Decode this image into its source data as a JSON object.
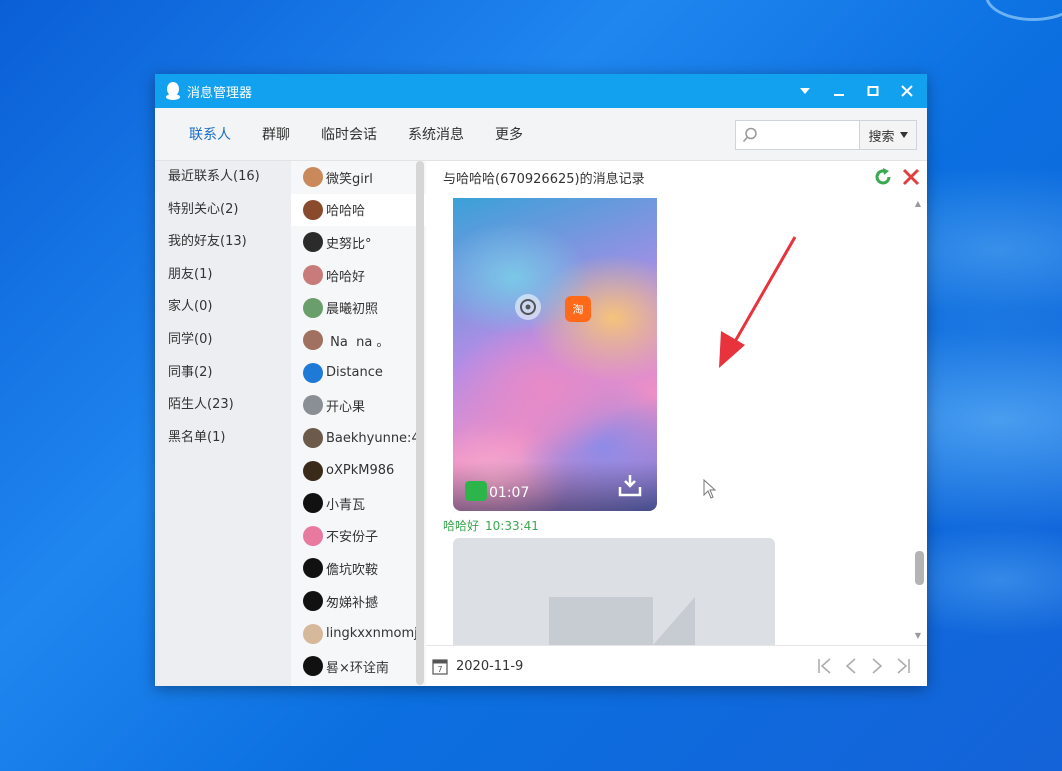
{
  "window": {
    "title": "消息管理器"
  },
  "nav": {
    "tabs": [
      {
        "label": "联系人"
      },
      {
        "label": "群聊"
      },
      {
        "label": "临时会话"
      },
      {
        "label": "系统消息"
      },
      {
        "label": "更多"
      }
    ],
    "active_tab": "联系人",
    "search_placeholder": "",
    "search_button": "搜索"
  },
  "groups": [
    "最近联系人(16)",
    "特别关心(2)",
    "我的好友(13)",
    "朋友(1)",
    "家人(0)",
    "同学(0)",
    "同事(2)",
    "陌生人(23)",
    "黑名单(1)"
  ],
  "contacts": [
    {
      "name": "微笑girl",
      "avatar_color": "#c9895a"
    },
    {
      "name": "哈哈哈",
      "avatar_color": "#8a4a2c",
      "selected": true
    },
    {
      "name": "史努比°",
      "avatar_color": "#2b2b2b"
    },
    {
      "name": "哈哈好",
      "avatar_color": "#c97a7a"
    },
    {
      "name": "晨曦初照",
      "avatar_color": "#6a9e6a"
    },
    {
      "name": " Na  na 。",
      "avatar_color": "#a07060"
    },
    {
      "name": "Distance",
      "avatar_color": "#1e7ad6"
    },
    {
      "name": "开心果",
      "avatar_color": "#8a8f96"
    },
    {
      "name": "Baekhyunne:4",
      "avatar_color": "#6c5a4a"
    },
    {
      "name": "oXPkM986",
      "avatar_color": "#3a2a1a"
    },
    {
      "name": "小青瓦",
      "avatar_color": "#111111"
    },
    {
      "name": "不安份子",
      "avatar_color": "#e87aa0"
    },
    {
      "name": "儋坑吹鞍",
      "avatar_color": "#111111"
    },
    {
      "name": "匆娣补撼",
      "avatar_color": "#111111"
    },
    {
      "name": "lingkxxnmomj",
      "avatar_color": "#d6b89a"
    },
    {
      "name": "晷×环诠南",
      "avatar_color": "#111111"
    }
  ],
  "chat": {
    "header": "与哈哈哈(670926625)的消息记录",
    "video_time": "01:07",
    "sender": "哈哈好",
    "sender_time": "10:33:41",
    "date": "2020-11-9"
  },
  "colors": {
    "title_bar": "#12a1ee",
    "accent_tab": "#1b6ec5",
    "sender_green": "#3aa84f",
    "annotation_arrow": "#e8323c"
  }
}
